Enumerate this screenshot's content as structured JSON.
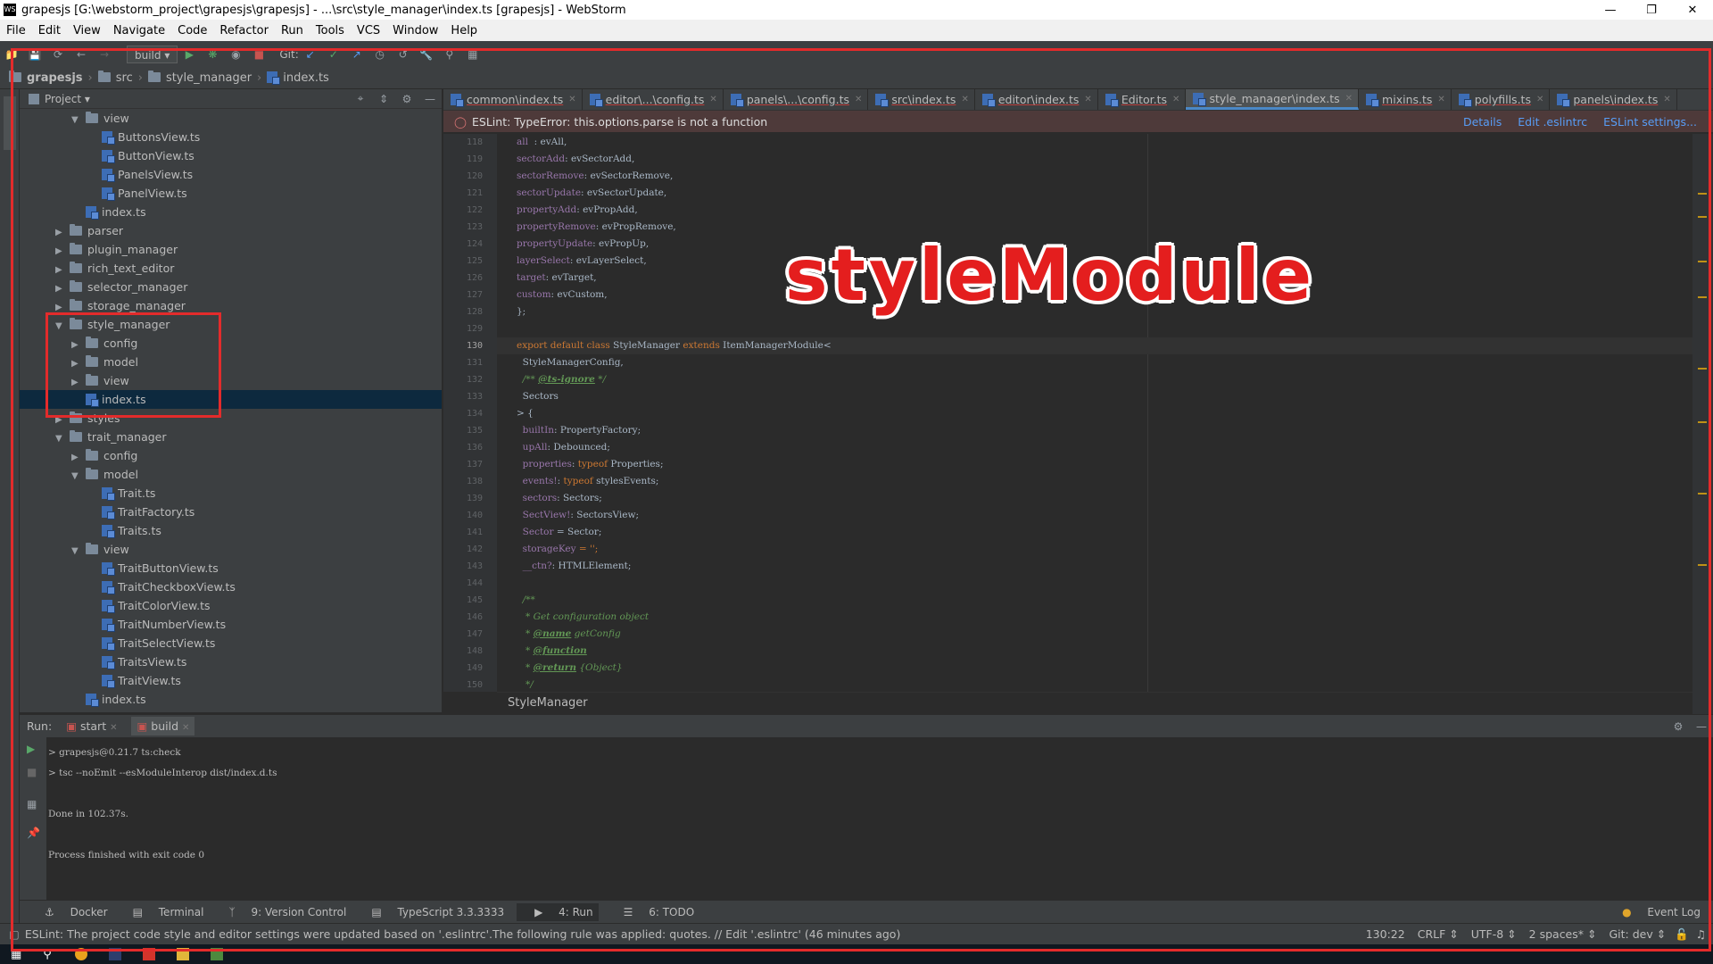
{
  "window": {
    "title": "grapesjs [G:\\webstorm_project\\grapesjs\\grapesjs] - ...\\src\\style_manager\\index.ts [grapesjs] - WebStorm"
  },
  "menu": [
    "File",
    "Edit",
    "View",
    "Navigate",
    "Code",
    "Refactor",
    "Run",
    "Tools",
    "VCS",
    "Window",
    "Help"
  ],
  "toolbar": {
    "run_config": "build",
    "git_label": "Git:"
  },
  "breadcrumb": [
    "grapesjs",
    "src",
    "style_manager",
    "index.ts"
  ],
  "project_panel": {
    "title": "Project"
  },
  "tree": [
    {
      "label": "view",
      "type": "folder",
      "depth": 2,
      "state": "open"
    },
    {
      "label": "ButtonsView.ts",
      "type": "file",
      "depth": 3
    },
    {
      "label": "ButtonView.ts",
      "type": "file",
      "depth": 3
    },
    {
      "label": "PanelsView.ts",
      "type": "file",
      "depth": 3
    },
    {
      "label": "PanelView.ts",
      "type": "file",
      "depth": 3
    },
    {
      "label": "index.ts",
      "type": "file",
      "depth": 2
    },
    {
      "label": "parser",
      "type": "folder",
      "depth": 1,
      "state": "closed"
    },
    {
      "label": "plugin_manager",
      "type": "folder",
      "depth": 1,
      "state": "closed"
    },
    {
      "label": "rich_text_editor",
      "type": "folder",
      "depth": 1,
      "state": "closed"
    },
    {
      "label": "selector_manager",
      "type": "folder",
      "depth": 1,
      "state": "closed"
    },
    {
      "label": "storage_manager",
      "type": "folder",
      "depth": 1,
      "state": "closed"
    },
    {
      "label": "style_manager",
      "type": "folder",
      "depth": 1,
      "state": "open"
    },
    {
      "label": "config",
      "type": "folder",
      "depth": 2,
      "state": "closed"
    },
    {
      "label": "model",
      "type": "folder",
      "depth": 2,
      "state": "closed"
    },
    {
      "label": "view",
      "type": "folder",
      "depth": 2,
      "state": "closed"
    },
    {
      "label": "index.ts",
      "type": "file",
      "depth": 2,
      "selected": true
    },
    {
      "label": "styles",
      "type": "folder",
      "depth": 1,
      "state": "closed"
    },
    {
      "label": "trait_manager",
      "type": "folder",
      "depth": 1,
      "state": "open"
    },
    {
      "label": "config",
      "type": "folder",
      "depth": 2,
      "state": "closed"
    },
    {
      "label": "model",
      "type": "folder",
      "depth": 2,
      "state": "open"
    },
    {
      "label": "Trait.ts",
      "type": "file",
      "depth": 3
    },
    {
      "label": "TraitFactory.ts",
      "type": "file",
      "depth": 3
    },
    {
      "label": "Traits.ts",
      "type": "file",
      "depth": 3
    },
    {
      "label": "view",
      "type": "folder",
      "depth": 2,
      "state": "open"
    },
    {
      "label": "TraitButtonView.ts",
      "type": "file",
      "depth": 3
    },
    {
      "label": "TraitCheckboxView.ts",
      "type": "file",
      "depth": 3
    },
    {
      "label": "TraitColorView.ts",
      "type": "file",
      "depth": 3
    },
    {
      "label": "TraitNumberView.ts",
      "type": "file",
      "depth": 3
    },
    {
      "label": "TraitSelectView.ts",
      "type": "file",
      "depth": 3
    },
    {
      "label": "TraitsView.ts",
      "type": "file",
      "depth": 3
    },
    {
      "label": "TraitView.ts",
      "type": "file",
      "depth": 3
    },
    {
      "label": "index.ts",
      "type": "file",
      "depth": 2
    }
  ],
  "tabs": [
    {
      "label": "common\\index.ts"
    },
    {
      "label": "editor\\...\\config.ts"
    },
    {
      "label": "panels\\...\\config.ts"
    },
    {
      "label": "src\\index.ts"
    },
    {
      "label": "editor\\index.ts"
    },
    {
      "label": "Editor.ts"
    },
    {
      "label": "style_manager\\index.ts",
      "active": true
    },
    {
      "label": "mixins.ts"
    },
    {
      "label": "polyfills.ts"
    },
    {
      "label": "panels\\index.ts"
    }
  ],
  "eslint_banner": {
    "message": "ESLint: TypeError: this.options.parse is not a function",
    "details": "Details",
    "edit": "Edit .eslintrc",
    "settings": "ESLint settings..."
  },
  "overlay_text": "styleModule",
  "code_lines": [
    {
      "n": "118",
      "t": [
        [
          "fd",
          "all"
        ],
        [
          "",
          "  : evAll,"
        ]
      ]
    },
    {
      "n": "119",
      "t": [
        [
          "fd",
          "sectorAdd"
        ],
        [
          "",
          ": evSectorAdd,"
        ]
      ]
    },
    {
      "n": "120",
      "t": [
        [
          "fd",
          "sectorRemove"
        ],
        [
          "",
          ": evSectorRemove,"
        ]
      ]
    },
    {
      "n": "121",
      "t": [
        [
          "fd",
          "sectorUpdate"
        ],
        [
          "",
          ": evSectorUpdate,"
        ]
      ]
    },
    {
      "n": "122",
      "t": [
        [
          "fd",
          "propertyAdd"
        ],
        [
          "",
          ": evPropAdd,"
        ]
      ]
    },
    {
      "n": "123",
      "t": [
        [
          "fd",
          "propertyRemove"
        ],
        [
          "",
          ": evPropRemove,"
        ]
      ]
    },
    {
      "n": "124",
      "t": [
        [
          "fd",
          "propertyUpdate"
        ],
        [
          "",
          ": evPropUp,"
        ]
      ]
    },
    {
      "n": "125",
      "t": [
        [
          "fd",
          "layerSelect"
        ],
        [
          "",
          ": evLayerSelect,"
        ]
      ]
    },
    {
      "n": "126",
      "t": [
        [
          "fd",
          "target"
        ],
        [
          "",
          ": evTarget,"
        ]
      ]
    },
    {
      "n": "127",
      "t": [
        [
          "fd",
          "custom"
        ],
        [
          "",
          ": evCustom,"
        ]
      ]
    },
    {
      "n": "128",
      "t": [
        [
          "",
          "};"
        ]
      ]
    },
    {
      "n": "129",
      "t": [
        [
          "",
          ""
        ]
      ]
    },
    {
      "n": "130",
      "t": [
        [
          "kw",
          "export default class "
        ],
        [
          "",
          "StyleManager "
        ],
        [
          "kw",
          "extends "
        ],
        [
          "",
          "ItemManagerModule<"
        ]
      ]
    },
    {
      "n": "131",
      "t": [
        [
          "",
          "  StyleManagerConfig,"
        ]
      ]
    },
    {
      "n": "132",
      "t": [
        [
          "cm",
          "  /** "
        ],
        [
          "tg",
          "@ts-ignore"
        ],
        [
          "cm",
          " */"
        ]
      ]
    },
    {
      "n": "133",
      "t": [
        [
          "",
          "  Sectors"
        ]
      ]
    },
    {
      "n": "134",
      "t": [
        [
          "",
          "> {"
        ]
      ]
    },
    {
      "n": "135",
      "t": [
        [
          "fd",
          "  builtIn"
        ],
        [
          "",
          ": PropertyFactory;"
        ]
      ]
    },
    {
      "n": "136",
      "t": [
        [
          "fd",
          "  upAll"
        ],
        [
          "",
          ": Debounced;"
        ]
      ]
    },
    {
      "n": "137",
      "t": [
        [
          "fd",
          "  properties"
        ],
        [
          "",
          ": "
        ],
        [
          "kw",
          "typeof "
        ],
        [
          "",
          "Properties;"
        ]
      ]
    },
    {
      "n": "138",
      "t": [
        [
          "fd",
          "  events!"
        ],
        [
          "",
          ": "
        ],
        [
          "kw",
          "typeof "
        ],
        [
          "",
          "stylesEvents;"
        ]
      ]
    },
    {
      "n": "139",
      "t": [
        [
          "fd",
          "  sectors"
        ],
        [
          "",
          ": Sectors;"
        ]
      ]
    },
    {
      "n": "140",
      "t": [
        [
          "fd",
          "  SectView!"
        ],
        [
          "",
          ": SectorsView;"
        ]
      ]
    },
    {
      "n": "141",
      "t": [
        [
          "fd",
          "  Sector"
        ],
        [
          "",
          " = Sector;"
        ]
      ]
    },
    {
      "n": "142",
      "t": [
        [
          "fd",
          "  storageKey"
        ],
        [
          "kw",
          " = '';"
        ]
      ]
    },
    {
      "n": "143",
      "t": [
        [
          "fd",
          "  __ctn?"
        ],
        [
          "",
          ": HTMLElement;"
        ]
      ]
    },
    {
      "n": "144",
      "t": [
        [
          "",
          ""
        ]
      ]
    },
    {
      "n": "145",
      "t": [
        [
          "cm",
          "  /**"
        ]
      ]
    },
    {
      "n": "146",
      "t": [
        [
          "cm",
          "   * Get configuration object"
        ]
      ]
    },
    {
      "n": "147",
      "t": [
        [
          "cm",
          "   * "
        ],
        [
          "tg",
          "@name"
        ],
        [
          "cm",
          " getConfig"
        ]
      ]
    },
    {
      "n": "148",
      "t": [
        [
          "cm",
          "   * "
        ],
        [
          "tg",
          "@function"
        ]
      ]
    },
    {
      "n": "149",
      "t": [
        [
          "cm",
          "   * "
        ],
        [
          "tg",
          "@return"
        ],
        [
          "cm",
          " {Object}"
        ]
      ]
    },
    {
      "n": "150",
      "t": [
        [
          "cm",
          "   */"
        ]
      ]
    }
  ],
  "editor_breadcrumb": "StyleManager",
  "run_panel": {
    "label": "Run:",
    "tabs": [
      {
        "label": "start"
      },
      {
        "label": "build",
        "active": true
      }
    ],
    "console": [
      "> grapesjs@0.21.7 ts:check",
      "> tsc --noEmit --esModuleInterop dist/index.d.ts",
      "",
      "Done in 102.37s.",
      "",
      "Process finished with exit code 0"
    ]
  },
  "bottom_tools": [
    "Docker",
    "Terminal",
    "9: Version Control",
    "TypeScript 3.3.3333",
    "4: Run",
    "6: TODO"
  ],
  "event_log": "Event Log",
  "status": {
    "message": "ESLint: The project code style and editor settings were updated based on '.eslintrc'.The following rule was applied: quotes. // Edit '.eslintrc' (46 minutes ago)",
    "position": "130:22",
    "line_sep": "CRLF",
    "encoding": "UTF-8",
    "indent": "2 spaces*",
    "git": "Git: dev"
  },
  "colors": {
    "highlight": "#e32b2b",
    "overlay": "#e41e1e",
    "accent": "#4a88c7"
  }
}
